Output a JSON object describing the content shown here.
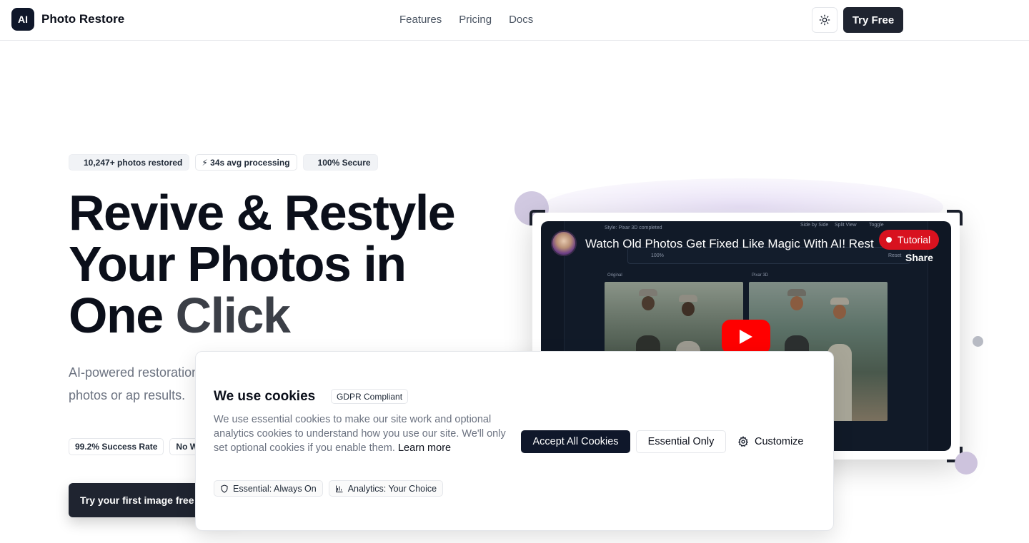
{
  "header": {
    "logo_badge": "AI",
    "logo_text": "Photo Restore",
    "nav": [
      "Features",
      "Pricing",
      "Docs"
    ],
    "try_label": "Try Free"
  },
  "hero": {
    "stats": [
      "10,247+ photos restored",
      "⚡ 34s avg processing",
      "100% Secure"
    ],
    "headline_line1": "Revive & Restyle",
    "headline_line2": "Your Photos in",
    "headline_line3a": "One ",
    "headline_line3b": "Click",
    "subtext": "AI-powered restoration damaged photos or ap results.",
    "pills": [
      "99.2% Success Rate",
      "No W"
    ],
    "cta_label": "Try your first image free"
  },
  "video": {
    "title": "Watch Old Photos Get Fixed Like Magic With AI! Rest",
    "share_label": "Share",
    "tutorial_label": "Tutorial",
    "toolbar_style": "Style: Pixar 3D completed",
    "zoom": "100%",
    "reset": "Reset",
    "view_modes": [
      "Side by Side",
      "Split View",
      "Toggle"
    ],
    "label_original": "Original",
    "label_result": "Pixar 3D"
  },
  "cookie": {
    "title": "We use cookies",
    "badge": "GDPR Compliant",
    "text": "We use essential cookies to make our site work and optional analytics cookies to understand how you use our site. We'll only set optional cookies if you enable them.",
    "learn_more": "Learn more",
    "tag_essential": "Essential: Always On",
    "tag_analytics": "Analytics: Your Choice",
    "accept_label": "Accept All Cookies",
    "essential_label": "Essential Only",
    "customize_label": "Customize"
  },
  "colors": {
    "primary_dark": "#1f2430",
    "youtube_red": "#ff0000",
    "tutorial_red": "#d8121f"
  }
}
